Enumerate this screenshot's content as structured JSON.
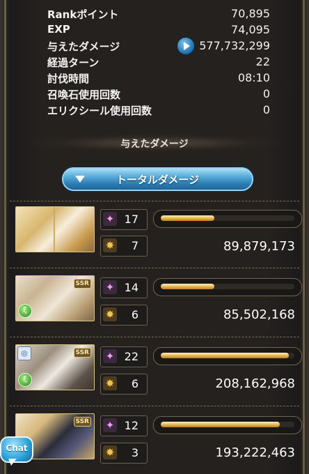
{
  "stats": [
    {
      "label": "Rankポイント",
      "value": "70,895"
    },
    {
      "label": "EXP",
      "value": "74,095"
    },
    {
      "label": "与えたダメージ",
      "value": "577,732,299"
    },
    {
      "label": "経過ターン",
      "value": "22"
    },
    {
      "label": "討伐時間",
      "value": "08:10"
    },
    {
      "label": "召喚石使用回数",
      "value": "0"
    },
    {
      "label": "エリクシール使用回数",
      "value": "0"
    }
  ],
  "section_title": "与えたダメージ",
  "dropdown_label": "トータルダメージ",
  "rows": [
    {
      "ougi": "17",
      "chain": "7",
      "damage": "89,879,173",
      "bar": 0.4
    },
    {
      "ougi": "14",
      "chain": "6",
      "damage": "85,502,168",
      "bar": 0.4
    },
    {
      "ougi": "22",
      "chain": "6",
      "damage": "208,162,968",
      "bar": 0.96
    },
    {
      "ougi": "12",
      "chain": "3",
      "damage": "193,222,463",
      "bar": 0.89
    }
  ],
  "ssr_badge": "SSR",
  "chat_label": "Chat",
  "icons": {
    "play": "play-icon",
    "ougi": "sparkle-icon",
    "chain": "chain-burst-icon",
    "element": "wind-element-icon",
    "job": "ring-icon"
  },
  "colors": {
    "bar_fill": "#e4b44e",
    "dropdown": "#2d7cb2",
    "chat": "#2aa0d8"
  }
}
